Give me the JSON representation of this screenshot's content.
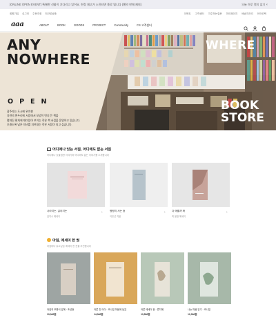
{
  "topbar": {
    "message": "[ONLINE OPEN EVENT] 특별한 선물이 기다리고 있어요. 한정 재고가 소진되면 종료 됩니다 (예약 판매 제외)",
    "close_label": "오늘 하루 열지 않기 ×"
  },
  "utilbar": {
    "left": [
      "회원가입",
      "로그인",
      "주문조회",
      "최근본상품"
    ],
    "right": [
      "이벤트",
      "고객센터",
      "자주하는질문",
      "마이페이지",
      "배송지관리",
      "언어선택"
    ]
  },
  "nav": {
    "logo": "aaa",
    "menu": [
      "ABOUT",
      "BOOK",
      "GOODS",
      "PROJECT",
      "Community",
      "CS 고객센터"
    ],
    "icons": [
      "search-icon",
      "user-icon",
      "cart-icon"
    ]
  },
  "hero": {
    "headline_1": "ANY",
    "headline_2": "NOWHERE",
    "where": "WHERE",
    "open": "OPEN",
    "copy": [
      "광주라는 도시에 위치한",
      "자연의 변두리에 서점에서 모양이 먼지 든 책을",
      "펼쳐진 편처에 재미있어 보이는 작은 책 서점을 운영하고 있습니다.",
      "오래도록 남은 지비를 지켜내는 작은 서점이 되고 싶습니다."
    ],
    "book": "BOOK",
    "store": "STORE"
  },
  "section1": {
    "title": "어디에나 있는 서점, 어디에도 없는 서점",
    "subtitle": "어디에나 있을법한 이야기와 어디에도 없는 이야기를 소개합니다",
    "items": [
      {
        "title": "사라지는, 살아지는",
        "author": "김지수 에세이",
        "cover": "#f1d9d9"
      },
      {
        "title": "평평히 서는 중",
        "author": "이유선 지음",
        "cover": "#b7c4cc"
      },
      {
        "title": "다 예쁠까 봐",
        "author": "최 윤정 에세이",
        "cover": "#c9a59c"
      }
    ]
  },
  "section2": {
    "title": "아침, 에세이 한 권",
    "subtitle": "아침마다 읽고싶은 에세이 한 권을 추천합니다",
    "items": [
      {
        "title": "아침의 모퉁이 앞에 · 조성현",
        "price": "13,000원",
        "bg": "#9ea5a3",
        "cover": "#d8cfc4"
      },
      {
        "title": "어른 친 아이 · 조나일 마음에 남은",
        "price": "14,000원",
        "bg": "#d9a75a",
        "cover": "#f1e4d0"
      },
      {
        "title": "어른 에세이 한 · 류지혜",
        "price": "13,500원",
        "bg": "#b8c8b8",
        "cover": "#e7e3d8"
      },
      {
        "title": "나는 마음 읽기 · 조나일",
        "price": "12,000원",
        "bg": "#a7b8a9",
        "cover": "#dfe6df"
      }
    ]
  }
}
